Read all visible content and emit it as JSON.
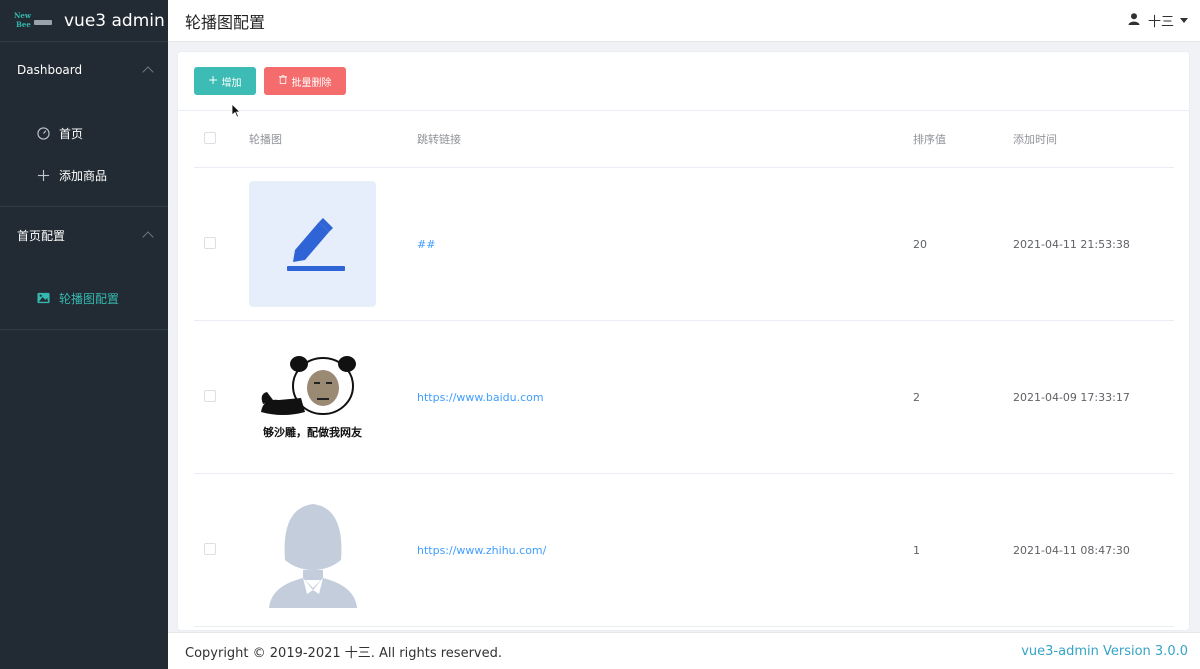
{
  "app": {
    "logo_line1": "New",
    "logo_line2": "Bee",
    "title": "vue3 admin"
  },
  "sidebar": {
    "groups": [
      {
        "label": "Dashboard",
        "items": [
          {
            "label": "首页",
            "icon": "dashboard-icon"
          },
          {
            "label": "添加商品",
            "icon": "plus-icon"
          }
        ]
      },
      {
        "label": "首页配置",
        "items": [
          {
            "label": "轮播图配置",
            "icon": "picture-icon",
            "active": true
          }
        ]
      }
    ]
  },
  "header": {
    "title": "轮播图配置",
    "user_name": "十三"
  },
  "toolbar": {
    "add_label": "增加",
    "batch_delete_label": "批量删除"
  },
  "table": {
    "columns": [
      "轮播图",
      "跳转链接",
      "排序值",
      "添加时间"
    ],
    "rows": [
      {
        "image": "edit-pen-icon",
        "link": "##",
        "sort": "20",
        "time": "2021-04-11 21:53:38"
      },
      {
        "image": "panda-meme-image",
        "caption": "够沙雕，配做我网友",
        "link": "https://www.baidu.com",
        "sort": "2",
        "time": "2021-04-09 17:33:17"
      },
      {
        "image": "avatar-placeholder-image",
        "link": "https://www.zhihu.com/",
        "sort": "1",
        "time": "2021-04-11 08:47:30"
      }
    ]
  },
  "footer": {
    "copyright": "Copyright © 2019-2021 十三. All rights reserved.",
    "version": "vue3-admin Version 3.0.0"
  },
  "colors": {
    "sidebar_bg": "#222b33",
    "accent": "#35b8b0",
    "danger": "#f56c6c",
    "link": "#409eff"
  }
}
